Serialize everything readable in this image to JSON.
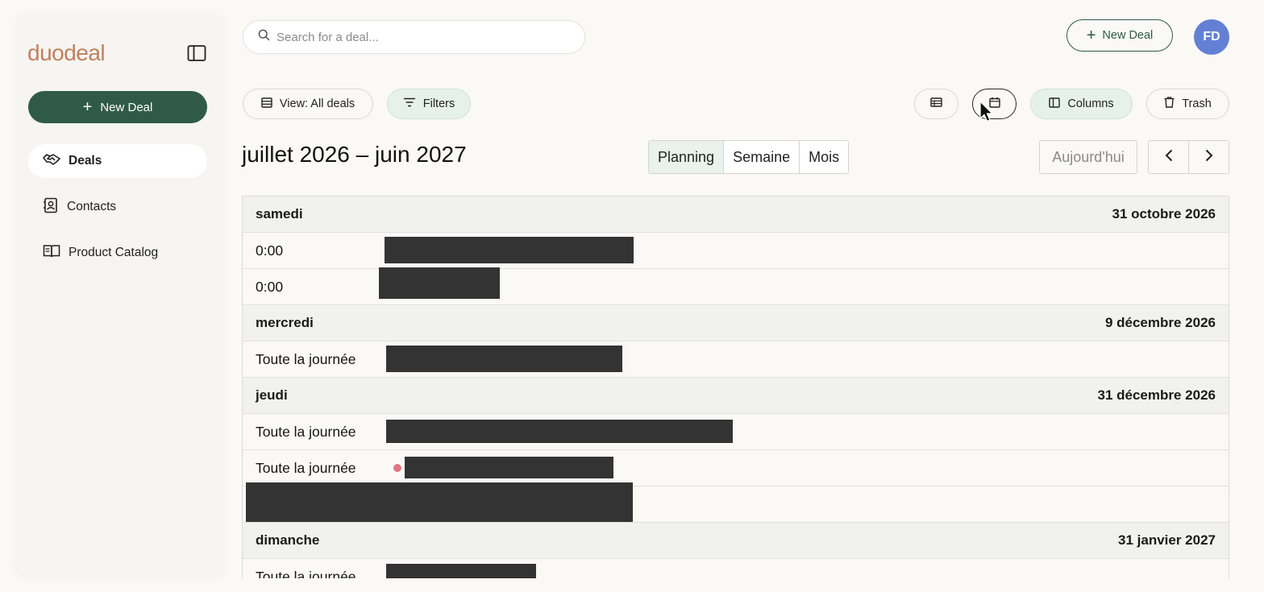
{
  "app": {
    "logo_text": "duodeal",
    "new_deal_label": "New Deal"
  },
  "sidebar": {
    "items": [
      {
        "label": "Deals",
        "icon": "handshake-icon",
        "active": true
      },
      {
        "label": "Contacts",
        "icon": "contact-book-icon",
        "active": false
      },
      {
        "label": "Product Catalog",
        "icon": "book-open-icon",
        "active": false
      }
    ]
  },
  "header": {
    "search_placeholder": "Search for a deal...",
    "new_deal_label": "New Deal",
    "avatar_initials": "FD",
    "avatar_color": "#6480d4"
  },
  "toolbar": {
    "view_label": "View: All deals",
    "filters_label": "Filters",
    "columns_label": "Columns",
    "trash_label": "Trash",
    "list_view_icon": "list-view-icon",
    "calendar_view_icon": "calendar-icon"
  },
  "calendar": {
    "range_title": "juillet 2026 – juin 2027",
    "views": [
      "Planning",
      "Semaine",
      "Mois"
    ],
    "active_view": "Planning",
    "today_label": "Aujourd'hui",
    "days": [
      {
        "weekday": "samedi",
        "date": "31 octobre 2026",
        "events": [
          {
            "time": "0:00"
          },
          {
            "time": "0:00"
          }
        ]
      },
      {
        "weekday": "mercredi",
        "date": "9 décembre 2026",
        "events": [
          {
            "time": "Toute la journée"
          }
        ]
      },
      {
        "weekday": "jeudi",
        "date": "31 décembre 2026",
        "events": [
          {
            "time": "Toute la journée"
          },
          {
            "time": "Toute la journée",
            "dot_color": "#e57381"
          },
          {
            "time": ""
          }
        ]
      },
      {
        "weekday": "dimanche",
        "date": "31 janvier 2027",
        "events": [
          {
            "time": "Toute la journée"
          }
        ]
      }
    ]
  },
  "colors": {
    "accent": "#2f5a4a",
    "logo": "#c0805f",
    "active_view_bg": "#e9f2ed",
    "redaction": "#333333"
  }
}
